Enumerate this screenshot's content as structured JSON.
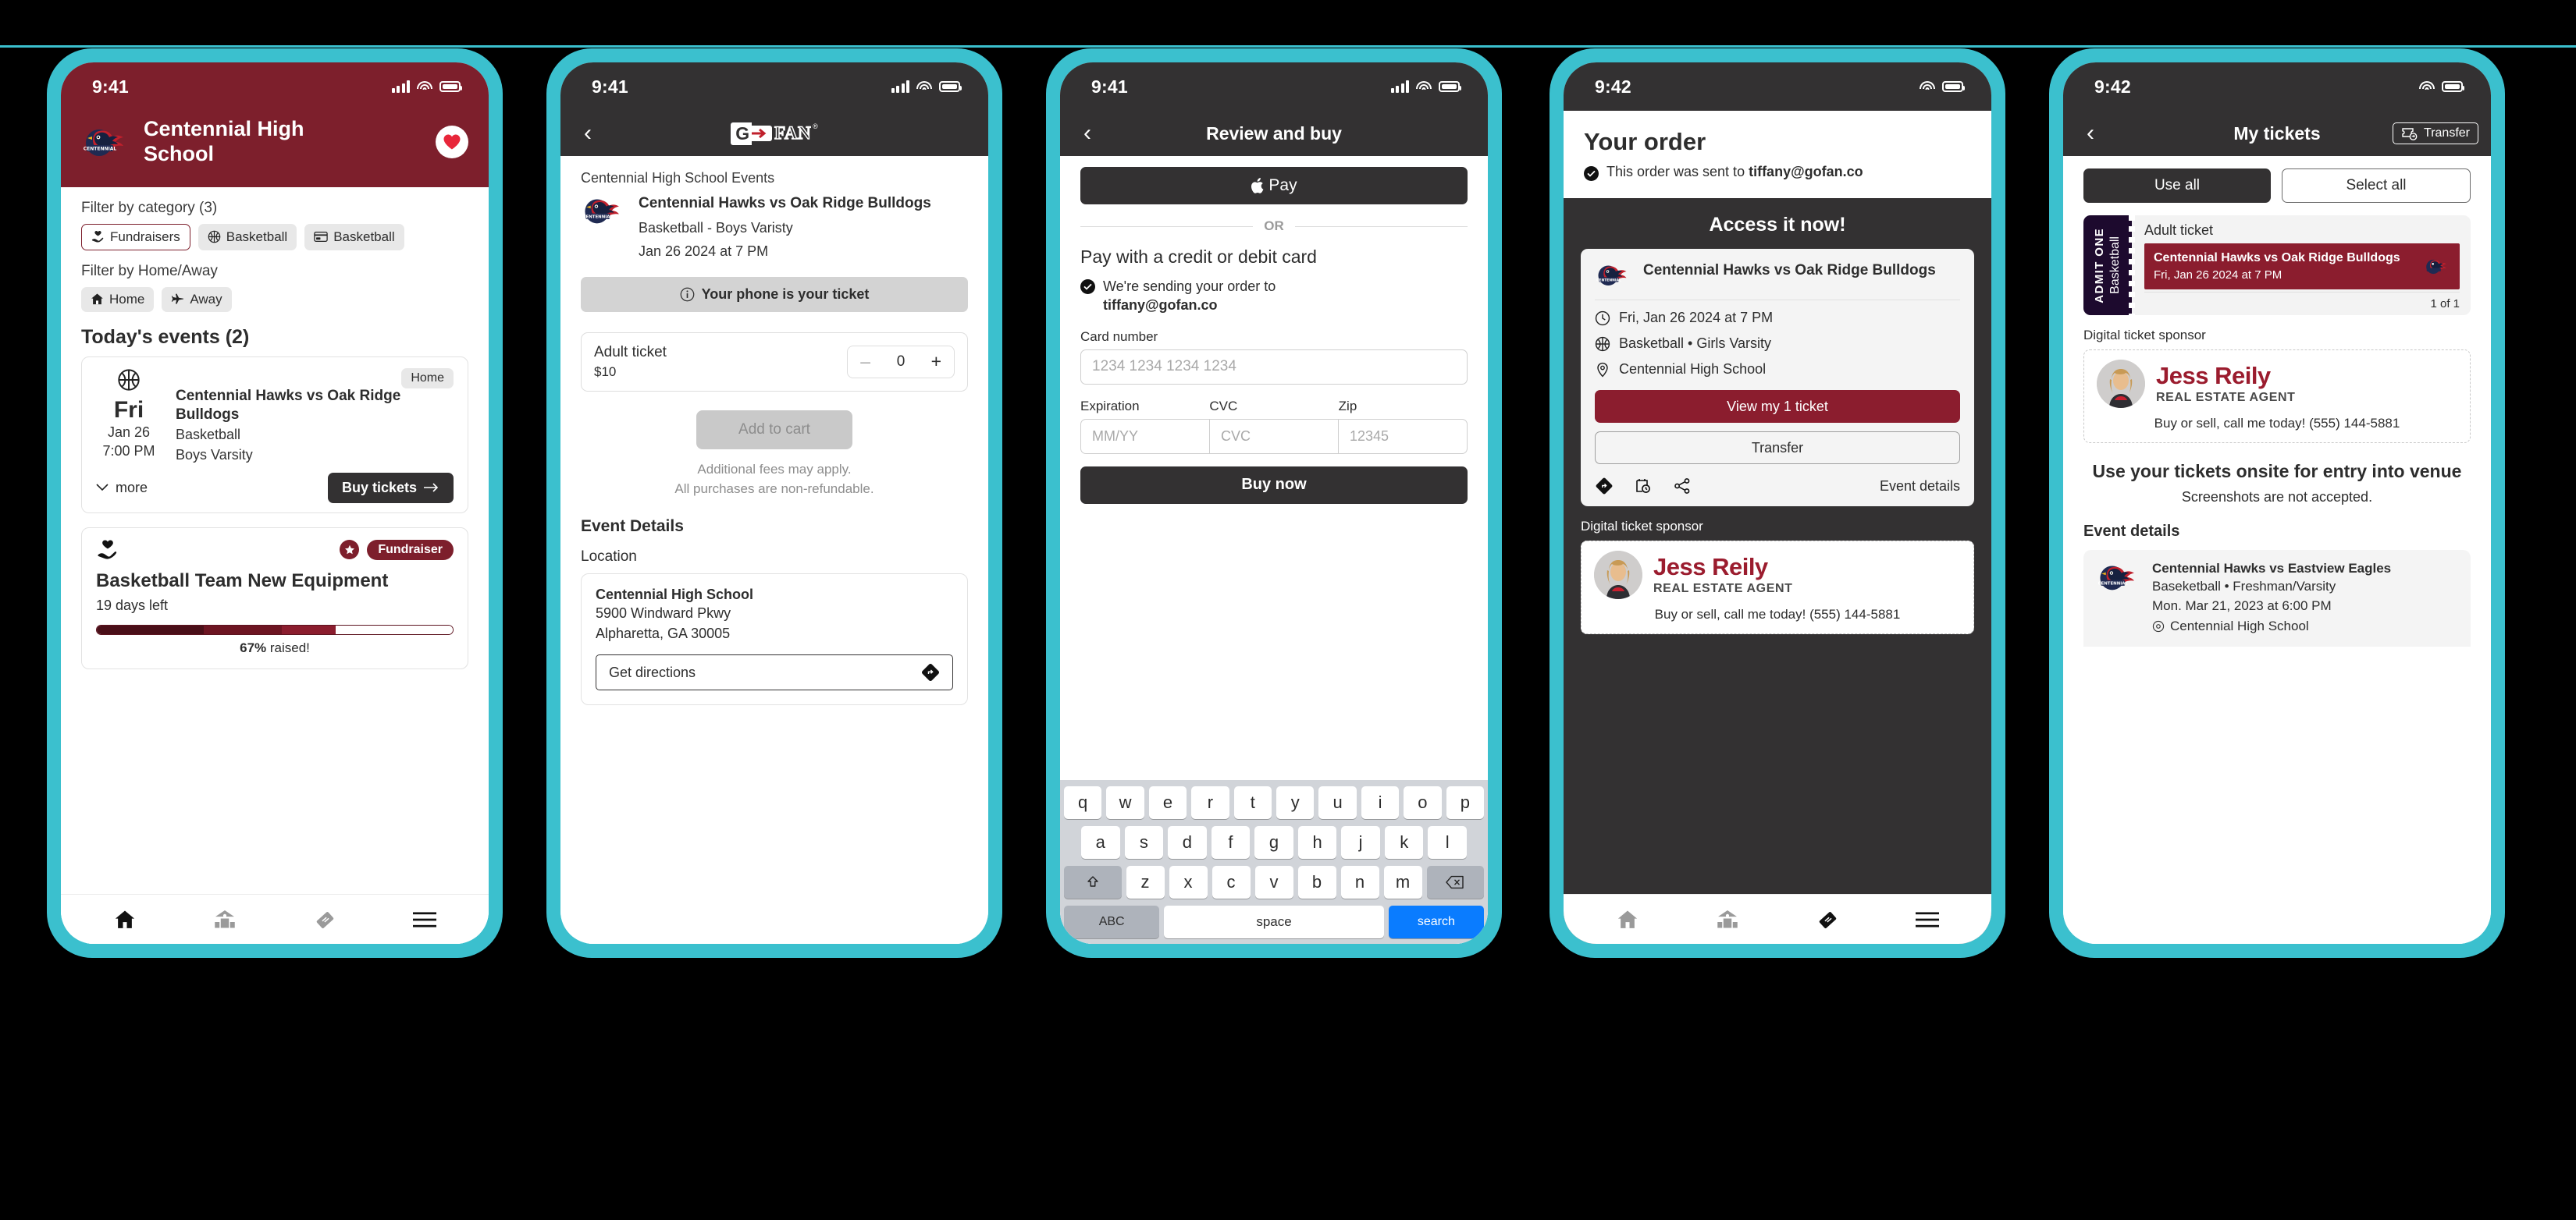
{
  "frame": {
    "accent": "#3bc0ce",
    "maroon": "#7d1f2c",
    "dark": "#333132"
  },
  "phone1": {
    "status": {
      "time": "9:41"
    },
    "header": {
      "school": "Centennial High\nSchool",
      "favorite_icon": "heart-icon"
    },
    "filters": {
      "category_label": "Filter by category (3)",
      "category_chips": [
        {
          "label": "Fundraisers",
          "icon": "hand-heart-icon",
          "selected": true
        },
        {
          "label": "Basketball",
          "icon": "basketball-icon",
          "selected": false
        },
        {
          "label": "Basketball",
          "icon": "ticket-card-icon",
          "selected": false
        }
      ],
      "homeaway_label": "Filter by Home/Away",
      "homeaway_chips": [
        {
          "label": "Home",
          "icon": "home-icon"
        },
        {
          "label": "Away",
          "icon": "airplane-icon"
        }
      ]
    },
    "events_title": "Today's events (2)",
    "event": {
      "day": "Fri",
      "date": "Jan 26",
      "time": "7:00 PM",
      "name": "Centennial Hawks vs Oak Ridge Bulldogs",
      "sport": "Basketball",
      "level": "Boys Varsity",
      "tag": "Home",
      "more_label": "more",
      "buy_label": "Buy tickets"
    },
    "fundraiser": {
      "pill": "Fundraiser",
      "title": "Basketball Team New Equipment",
      "days_left": "19 days left",
      "progress_pct": 67,
      "raised_value": "67%",
      "raised_suffix": " raised!"
    },
    "tabs": [
      "home-icon",
      "school-icon",
      "ticket-icon",
      "menu-icon"
    ]
  },
  "phone2": {
    "status": {
      "time": "9:41"
    },
    "nav": {
      "back_icon": "chevron-left-icon",
      "logo": "gofan-logo"
    },
    "breadcrumb": "Centennial High School Events",
    "event": {
      "name": "Centennial Hawks vs Oak Ridge Bulldogs",
      "sport": "Basketball - Boys Varisty",
      "datetime": "Jan 26 2024 at 7 PM"
    },
    "banner": "Your phone is your ticket",
    "ticket": {
      "name": "Adult ticket",
      "price": "$10",
      "qty": "0",
      "minus": "–",
      "plus": "+"
    },
    "add_to_cart": "Add to cart",
    "fineprint_1": "Additional fees may apply.",
    "fineprint_2": "All purchases are non-refundable.",
    "details_heading": "Event Details",
    "location_label": "Location",
    "location": {
      "name": "Centennial High School",
      "line1": "5900 Windward Pkwy",
      "line2": "Alpharetta, GA 30005",
      "directions": "Get directions"
    }
  },
  "phone3": {
    "status": {
      "time": "9:41"
    },
    "nav": {
      "title": "Review and buy",
      "back_icon": "chevron-left-icon"
    },
    "apple_pay": "Pay",
    "divider": "OR",
    "pay_heading": "Pay with a credit or debit card",
    "send_line1": "We're sending your order to",
    "send_email": "tiffany@gofan.co",
    "card_label": "Card number",
    "card_placeholder": "1234 1234 1234 1234",
    "exp_label": "Expiration",
    "exp_placeholder": "MM/YY",
    "cvc_label": "CVC",
    "cvc_placeholder": "CVC",
    "zip_label": "Zip",
    "zip_placeholder": "12345",
    "buy_now": "Buy now",
    "keyboard": {
      "row1": [
        "q",
        "w",
        "e",
        "r",
        "t",
        "y",
        "u",
        "i",
        "o",
        "p"
      ],
      "row2": [
        "a",
        "s",
        "d",
        "f",
        "g",
        "h",
        "j",
        "k",
        "l"
      ],
      "row3": [
        "z",
        "x",
        "c",
        "v",
        "b",
        "n",
        "m"
      ],
      "shift": "shift-icon",
      "backspace": "backspace-icon",
      "abc": "ABC",
      "space": "space",
      "go": "search"
    }
  },
  "phone4": {
    "status": {
      "time": "9:42"
    },
    "heading": "Your order",
    "sub": "This order was sent to ",
    "sub_email": "tiffany@gofan.co",
    "access_heading": "Access it now!",
    "ticket": {
      "name": "Centennial Hawks vs Oak Ridge Bulldogs",
      "when": "Fri, Jan 26 2024 at 7 PM",
      "sport": "Basketball • Girls Varsity",
      "venue": "Centennial High School",
      "view_label": "View my 1 ticket",
      "transfer_label": "Transfer",
      "event_details_label": "Event details"
    },
    "sponsor_label": "Digital ticket sponsor",
    "sponsor": {
      "name": "Jess Reily",
      "role": "REAL ESTATE AGENT",
      "cta": "Buy or sell, call me today! (555) 144-5881"
    },
    "tabs": [
      "home-icon",
      "school-icon",
      "ticket-icon",
      "menu-icon"
    ]
  },
  "phone5": {
    "status": {
      "time": "9:42"
    },
    "nav": {
      "title": "My tickets",
      "back_icon": "chevron-left-icon",
      "transfer": "Transfer",
      "transfer_icon": "ticket-transfer-icon"
    },
    "segments": [
      {
        "label": "Use all",
        "active": true
      },
      {
        "label": "Select all",
        "active": false
      }
    ],
    "stub": {
      "admit": "ADMIT ONE",
      "sport": "Basketball",
      "title": "Adult ticket",
      "event": "Centennial Hawks vs Oak Ridge Bulldogs",
      "datetime": "Fri, Jan 26 2024 at 7 PM",
      "count": "1 of 1"
    },
    "sponsor_label": "Digital ticket sponsor",
    "sponsor": {
      "name": "Jess Reily",
      "role": "REAL ESTATE AGENT",
      "cta": "Buy or sell, call me today! (555) 144-5881"
    },
    "use_onsite": "Use your tickets onsite for entry into venue",
    "screenshots_note": "Screenshots are not accepted.",
    "event_details_heading": "Event details",
    "event_details": {
      "name": "Centennial Hawks vs Eastview Eagles",
      "sport": "Baseketball • Freshman/Varsity",
      "when": "Mon. Mar 21, 2023 at 6:00 PM",
      "venue": "Centennial High School"
    }
  }
}
